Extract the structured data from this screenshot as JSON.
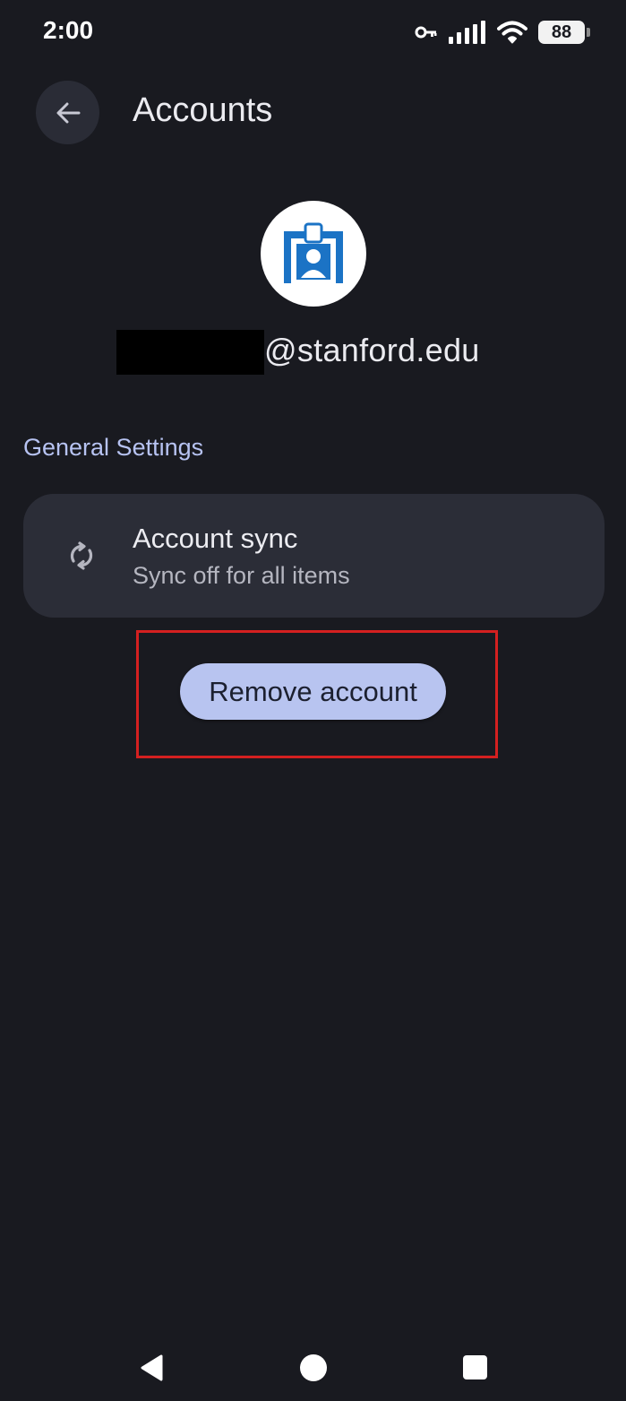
{
  "status_bar": {
    "time": "2:00",
    "battery_level": "88",
    "icons": [
      "vpn-key-icon",
      "signal-icon",
      "wifi-icon",
      "battery-icon"
    ]
  },
  "header": {
    "title": "Accounts",
    "back_icon": "arrow-back-icon"
  },
  "account": {
    "avatar_icon": "badge-id-icon",
    "email_domain": "@stanford.edu"
  },
  "general_settings": {
    "header": "General Settings",
    "sync": {
      "icon": "sync-icon",
      "title": "Account sync",
      "subtitle": "Sync off for all items"
    }
  },
  "actions": {
    "remove_label": "Remove account"
  },
  "colors": {
    "background": "#191a20",
    "card": "#2b2d37",
    "accent": "#b8c4f0",
    "section_header": "#b7c3f2",
    "highlight": "#d42020"
  },
  "nav_bar": {
    "icons": [
      "nav-back-icon",
      "nav-home-icon",
      "nav-recents-icon"
    ]
  }
}
